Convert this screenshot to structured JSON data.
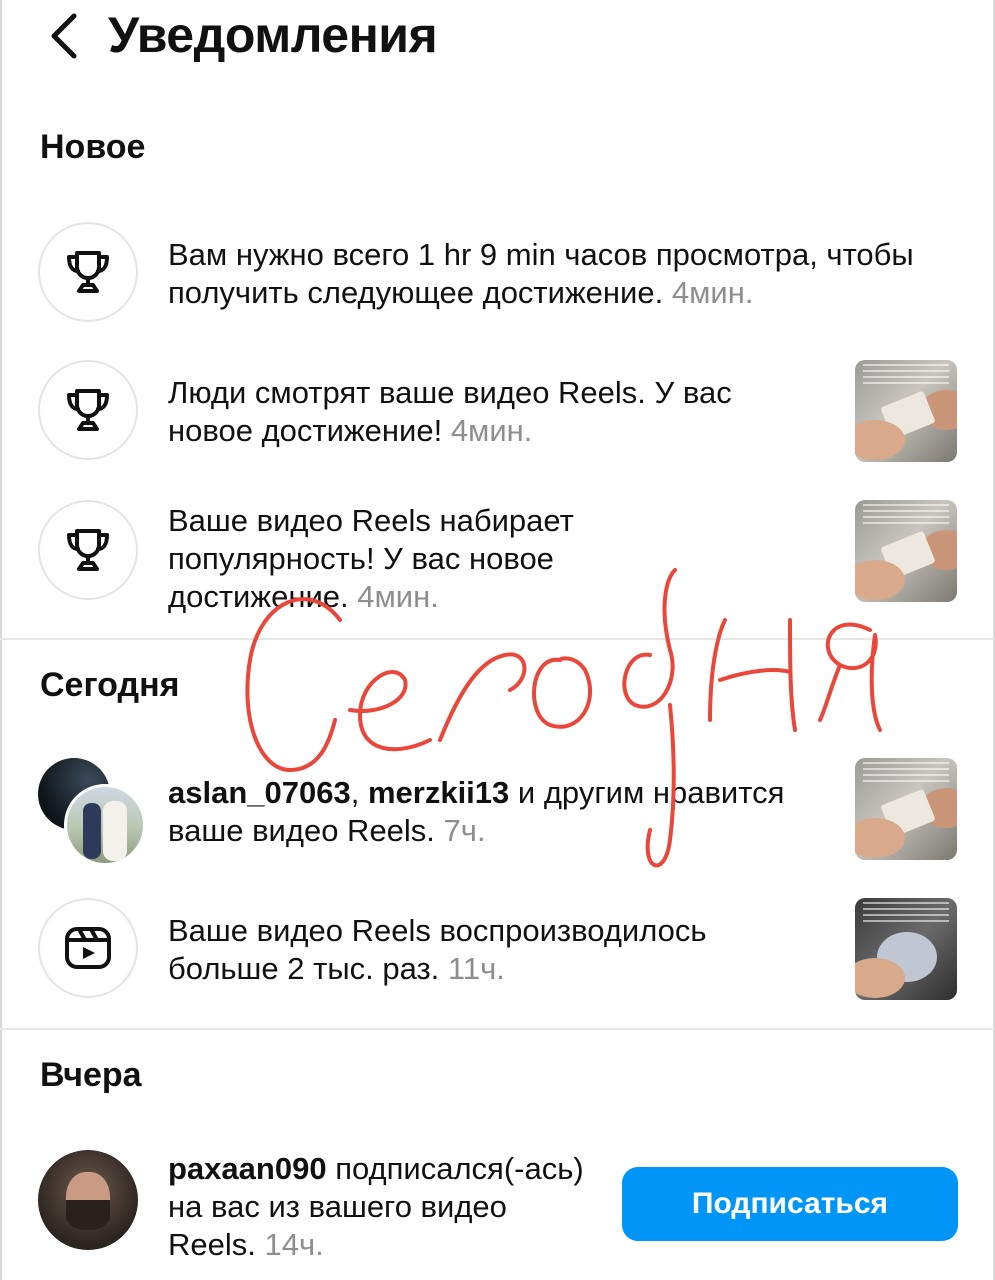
{
  "header": {
    "title": "Уведомления"
  },
  "sections": {
    "new": {
      "title": "Новое"
    },
    "today": {
      "title": "Сегодня"
    },
    "yesterday": {
      "title": "Вчера"
    }
  },
  "notifications": {
    "n1": {
      "text": "Вам нужно всего 1 hr 9 min часов просмотра, чтобы получить следующее достижение.",
      "time": "4мин.",
      "icon": "trophy-icon"
    },
    "n2": {
      "text": "Люди смотрят ваше видео Reels. У вас новое достижение!",
      "time": "4мин.",
      "icon": "trophy-icon"
    },
    "n3": {
      "text": "Ваше видео Reels набирает популярность! У вас новое достижение.",
      "time": "4мин.",
      "icon": "trophy-icon"
    },
    "n4": {
      "user1": "aslan_07063",
      "separator": ", ",
      "user2": "merzkii13",
      "text": "и другим нравится ваше видео Reels.",
      "time": "7ч."
    },
    "n5": {
      "text": "Ваше видео Reels воспроизводилось больше 2 тыс. раз.",
      "time": "11ч.",
      "icon": "reels-icon"
    },
    "n6": {
      "user": "paxaan090",
      "text": "подписался(-ась) на вас из вашего видео Reels.",
      "time": "14ч.",
      "button": "Подписаться"
    }
  },
  "annotation": {
    "text": "Сегодня",
    "color": "#e8473a"
  },
  "colors": {
    "accent": "#0095f6",
    "muted": "#8e8e8e"
  }
}
